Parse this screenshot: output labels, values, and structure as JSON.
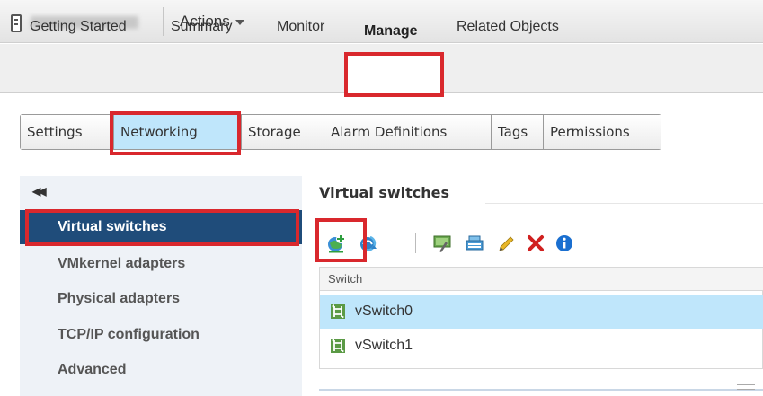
{
  "header": {
    "actions_label": "Actions"
  },
  "object_tabs": [
    {
      "label": "Getting Started"
    },
    {
      "label": "Summary"
    },
    {
      "label": "Monitor"
    },
    {
      "label": "Manage"
    },
    {
      "label": "Related Objects"
    }
  ],
  "sub_tabs": [
    {
      "label": "Settings"
    },
    {
      "label": "Networking"
    },
    {
      "label": "Storage"
    },
    {
      "label": "Alarm Definitions"
    },
    {
      "label": "Tags"
    },
    {
      "label": "Permissions"
    }
  ],
  "left_nav": {
    "collapse_icon": "double-chevron-left-icon",
    "items": [
      {
        "label": "Virtual switches"
      },
      {
        "label": "VMkernel adapters"
      },
      {
        "label": "Physical adapters"
      },
      {
        "label": "TCP/IP configuration"
      },
      {
        "label": "Advanced"
      }
    ]
  },
  "panel": {
    "title": "Virtual switches",
    "toolbar_icons": [
      "add-host-networking-icon",
      "refresh-icon",
      "migrate-adapter-icon",
      "manage-adapters-icon",
      "edit-icon",
      "remove-icon",
      "info-icon"
    ],
    "table": {
      "column_header": "Switch",
      "rows": [
        {
          "name": "vSwitch0"
        },
        {
          "name": "vSwitch1"
        }
      ]
    }
  },
  "colors": {
    "highlight_red": "#d9282d",
    "selected_nav_bg": "#1f4c7a",
    "selected_row_bg": "#bfe6fb",
    "info_blue": "#1a6fd0",
    "remove_red": "#d0201f"
  }
}
